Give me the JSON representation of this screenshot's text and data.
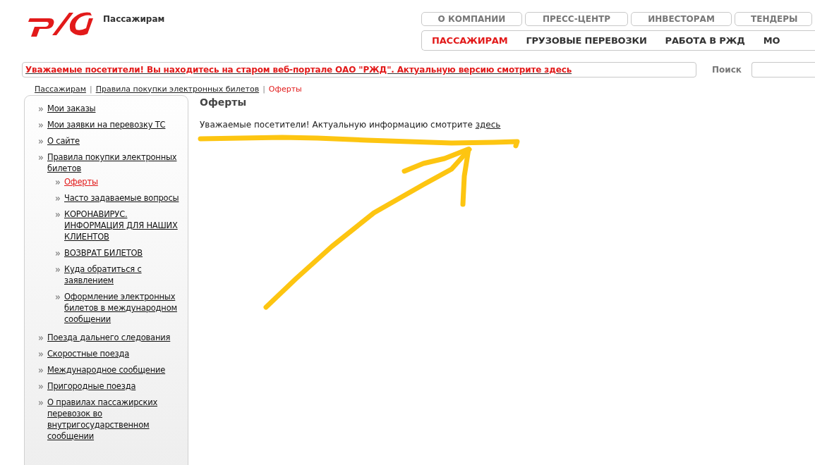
{
  "header": {
    "section_title": "Пассажирам"
  },
  "top_links": [
    {
      "label": "О КОМПАНИИ"
    },
    {
      "label": "ПРЕСС-ЦЕНТР"
    },
    {
      "label": "ИНВЕСТОРАМ"
    },
    {
      "label": "ТЕНДЕРЫ"
    }
  ],
  "main_nav": [
    {
      "label": "ПАССАЖИРАМ",
      "selected": true
    },
    {
      "label": "ГРУЗОВЫЕ ПЕРЕВОЗКИ",
      "selected": false
    },
    {
      "label": "РАБОТА В РЖД",
      "selected": false
    },
    {
      "label": "МО",
      "selected": false
    }
  ],
  "alert": {
    "text": "Уважаемые посетители! Вы находитесь на старом веб-портале ОАО \"РЖД\". Актуальную версию смотрите здесь"
  },
  "search": {
    "label": "Поиск"
  },
  "breadcrumb_separator": "|",
  "breadcrumb": [
    {
      "label": "Пассажирам",
      "current": false
    },
    {
      "label": "Правила покупки электронных билетов",
      "current": false
    },
    {
      "label": "Оферты",
      "current": true
    }
  ],
  "sidebar": {
    "items": [
      {
        "label": "Мои заказы",
        "selected": false
      },
      {
        "label": "Мои заявки на перевозку ТС",
        "selected": false
      },
      {
        "label": "О сайте",
        "selected": false
      },
      {
        "label": "Правила покупки электронных билетов",
        "selected": false,
        "children": [
          {
            "label": "Оферты",
            "selected": true
          },
          {
            "label": "Часто задаваемые вопросы",
            "selected": false
          },
          {
            "label": "КОРОНАВИРУС. ИНФОРМАЦИЯ ДЛЯ НАШИХ КЛИЕНТОВ",
            "selected": false
          },
          {
            "label": "ВОЗВРАТ БИЛЕТОВ",
            "selected": false
          },
          {
            "label": "Куда обратиться с заявлением",
            "selected": false
          },
          {
            "label": "Оформление электронных билетов в международном сообщении",
            "selected": false
          }
        ]
      },
      {
        "label": "Поезда дальнего следования",
        "selected": false
      },
      {
        "label": "Скоростные поезда",
        "selected": false
      },
      {
        "label": "Международное сообщение",
        "selected": false
      },
      {
        "label": "Пригородные поезда",
        "selected": false
      },
      {
        "label": "О правилах пассажирских перевозок во внутригосударственном сообщении",
        "selected": false
      }
    ]
  },
  "content": {
    "title": "Оферты",
    "text": "Уважаемые посетители! Актуальную информацию смотрите ",
    "link": "здесь"
  }
}
